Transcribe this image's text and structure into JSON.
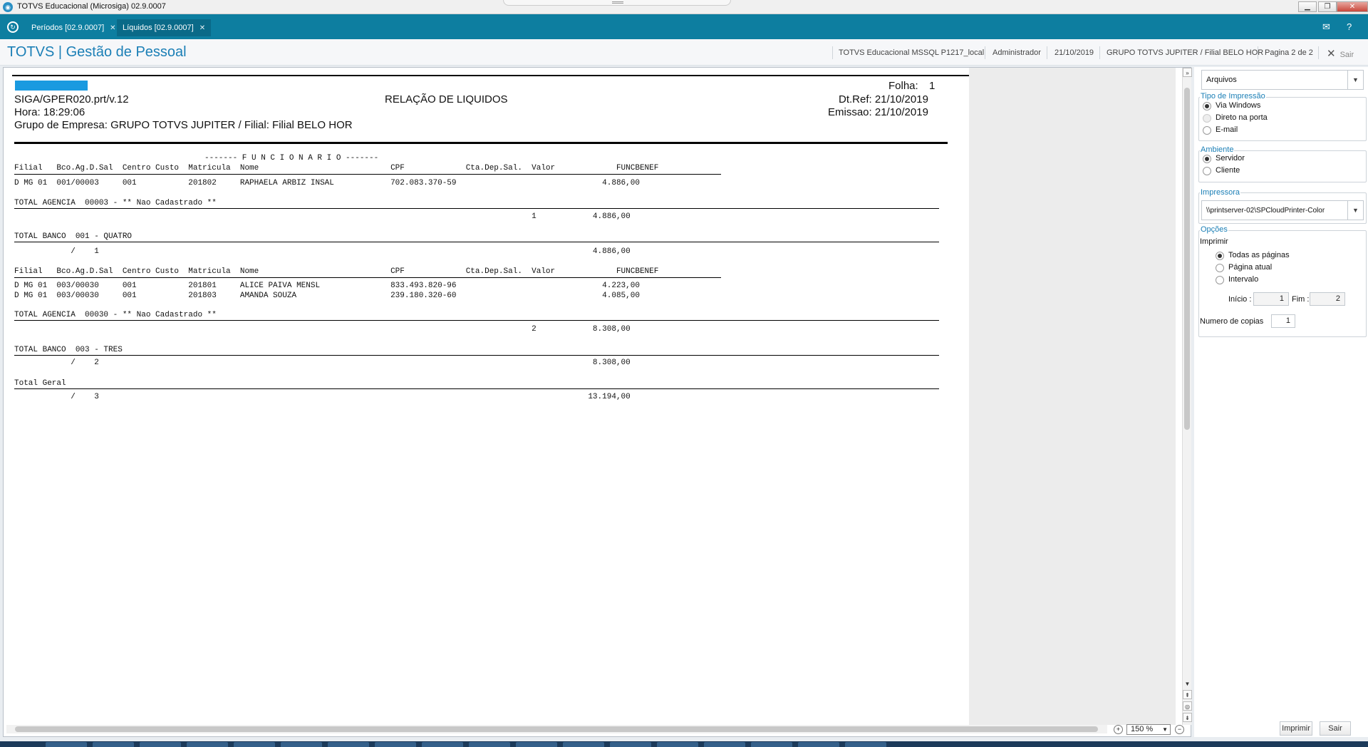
{
  "window": {
    "title": "TOTVS Educacional (Microsiga) 02.9.0007"
  },
  "tabs": [
    {
      "label": "Períodos [02.9.0007]"
    },
    {
      "label": "Líquidos [02.9.0007]"
    }
  ],
  "header": {
    "brand": "TOTVS | Gestão de Pessoal",
    "environment": "TOTVS Educacional MSSQL P1217_local",
    "user": "Administrador",
    "date": "21/10/2019",
    "company": "GRUPO TOTVS JUPITER / Filial BELO HOR",
    "page": "Pagina 2 de 2",
    "exit_label": "Sair"
  },
  "report": {
    "folha_label": "Folha:",
    "folha_value": "1",
    "program": "SIGA/GPER020.prt/v.12",
    "title": "RELAÇÃO DE LIQUIDOS",
    "dtref": "Dt.Ref: 21/10/2019",
    "hora": "Hora: 18:29:06",
    "emissao": "Emissao: 21/10/2019",
    "grupo": "Grupo de Empresa: GRUPO TOTVS JUPITER / Filial: Filial BELO HOR",
    "section_header": "------- F U N C I O N A R I O -------",
    "col_header": "Filial   Bco.Ag.D.Sal  Centro Custo  Matricula  Nome                            CPF             Cta.Dep.Sal.  Valor             FUNCBENEF",
    "row1": "D MG 01  001/00003     001           201802     RAPHAELA ARBIZ INSAL            702.083.370-59                               4.886,00",
    "total_agencia_1": "TOTAL AGENCIA  00003 - ** Nao Cadastrado **",
    "total_agencia_1_vals": "                                                                                                              1            4.886,00",
    "total_banco_1": "TOTAL BANCO  001 - QUATRO",
    "total_banco_1_vals": "            /    1                                                                                                         4.886,00",
    "col_header_2": "Filial   Bco.Ag.D.Sal  Centro Custo  Matricula  Nome                            CPF             Cta.Dep.Sal.  Valor             FUNCBENEF",
    "row2": "D MG 01  003/00030     001           201801     ALICE PAIVA MENSL               833.493.820-96                               4.223,00",
    "row3": "D MG 01  003/00030     001           201803     AMANDA SOUZA                    239.180.320-60                               4.085,00",
    "total_agencia_2": "TOTAL AGENCIA  00030 - ** Nao Cadastrado **",
    "total_agencia_2_vals": "                                                                                                              2            8.308,00",
    "total_banco_2": "TOTAL BANCO  003 - TRES",
    "total_banco_2_vals": "            /    2                                                                                                         8.308,00",
    "total_geral": "Total Geral",
    "total_geral_vals": "            /    3                                                                                                        13.194,00"
  },
  "zoom": {
    "value": "150 %"
  },
  "panel": {
    "destino_combo": "Arquivos",
    "tipo_title": "Tipo de Impressão",
    "tipo_options": [
      "Via Windows",
      "Direto na porta",
      "E-mail"
    ],
    "ambiente_title": "Ambiente",
    "ambiente_options": [
      "Servidor",
      "Cliente"
    ],
    "impressora_title": "Impressora",
    "impressora_value": "\\\\printserver-02\\SPCloudPrinter-Color",
    "opcoes_title": "Opções",
    "imprimir_label": "Imprimir",
    "imprimir_options": [
      "Todas as páginas",
      "Página atual",
      "Intervalo"
    ],
    "inicio_label": "Início :",
    "inicio_value": "1",
    "fim_label": "Fim :",
    "fim_value": "2",
    "copias_label": "Numero de copias",
    "copias_value": "1",
    "print_button": "Imprimir",
    "exit_button": "Sair"
  }
}
